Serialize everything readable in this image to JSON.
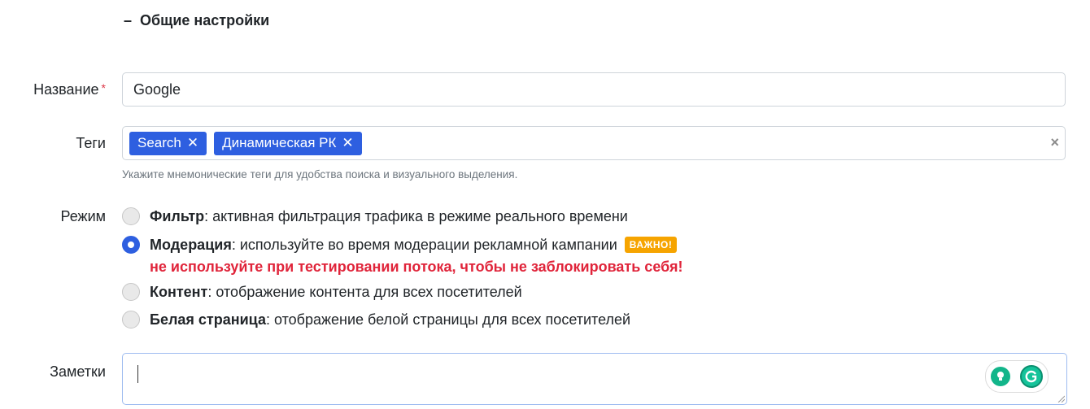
{
  "section": {
    "toggle": "–",
    "title": "Общие настройки"
  },
  "name_field": {
    "label": "Название",
    "required_mark": "*",
    "value": "Google"
  },
  "tags_field": {
    "label": "Теги",
    "tags": [
      {
        "text": "Search",
        "remove": "✕"
      },
      {
        "text": "Динамическая РК",
        "remove": "✕"
      }
    ],
    "clear": "×",
    "help": "Укажите мнемонические теги для удобства поиска и визуального выделения."
  },
  "mode_field": {
    "label": "Режим",
    "options": [
      {
        "title": "Фильтр",
        "desc": ": активная фильтрация трафика в режиме реального времени",
        "checked": false
      },
      {
        "title": "Модерация",
        "desc": ": используйте во время модерации рекламной кампании",
        "checked": true,
        "badge": "ВАЖНО!",
        "warning": "не используйте при тестировании потока, чтобы не заблокировать себя!"
      },
      {
        "title": "Контент",
        "desc": ": отображение контента для всех посетителей",
        "checked": false
      },
      {
        "title": "Белая страница",
        "desc": ": отображение белой страницы для всех посетителей",
        "checked": false
      }
    ]
  },
  "notes_field": {
    "label": "Заметки",
    "value": ""
  },
  "colors": {
    "accent": "#2e5fe0",
    "badge": "#f6a400",
    "warning": "#e0243a",
    "grammarly": "#15c39a"
  },
  "icons": {
    "tag_remove": "close-icon",
    "clear": "clear-all-icon",
    "bulb": "lightbulb-icon",
    "grammarly": "grammarly-icon",
    "resize": "resize-handle-icon"
  }
}
